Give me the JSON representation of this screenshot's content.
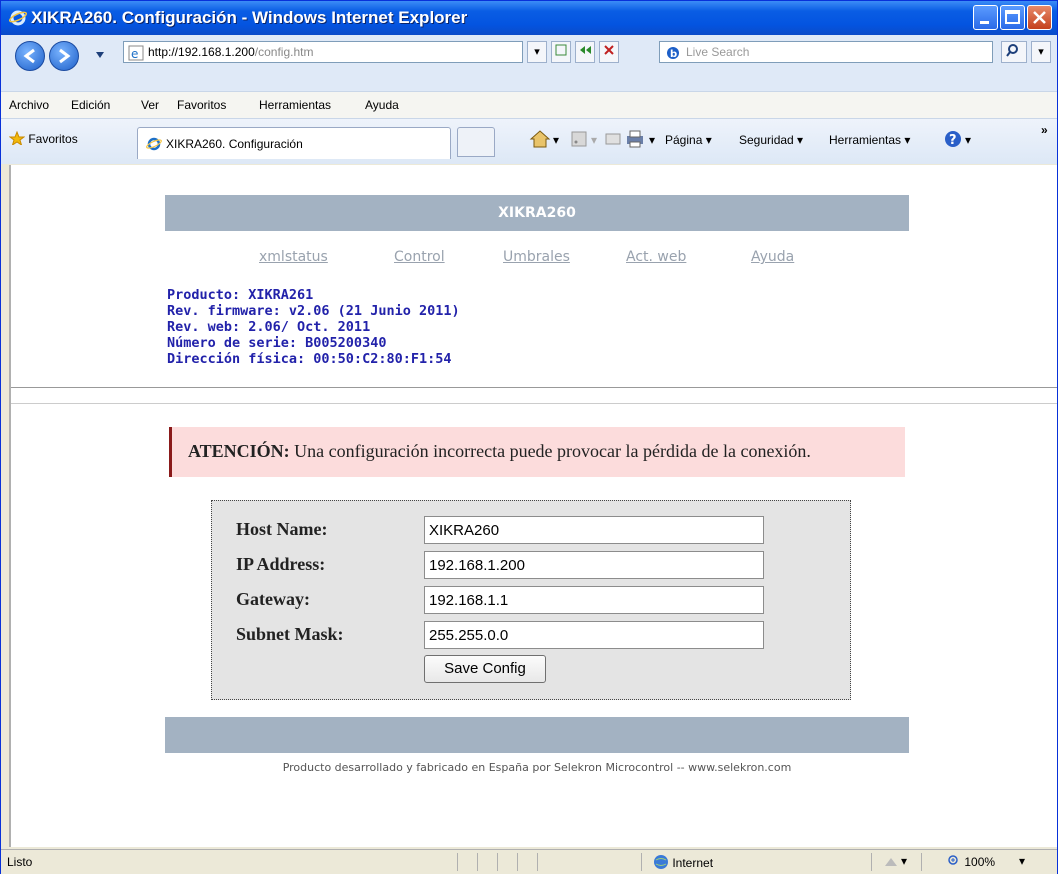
{
  "window": {
    "title": "XIKRA260. Configuración - Windows Internet Explorer"
  },
  "address": {
    "url_host": "http://192.168.1.200",
    "url_path": "/config.htm"
  },
  "search": {
    "placeholder": "Live Search"
  },
  "menu": [
    "Archivo",
    "Edición",
    "Ver",
    "Favoritos",
    "Herramientas",
    "Ayuda"
  ],
  "favorites": {
    "label": "Favoritos"
  },
  "tab": {
    "title": "XIKRA260. Configuración"
  },
  "commandbar": {
    "pagina": "Página",
    "seguridad": "Seguridad",
    "herramientas": "Herramientas"
  },
  "page": {
    "header": "XIKRA260",
    "nav": [
      "xmlstatus",
      "Control",
      "Umbrales",
      "Act. web",
      "Ayuda"
    ],
    "info": [
      "Producto: XIKRA261",
      "Rev. firmware: v2.06 (21 Junio 2011)",
      "Rev. web: 2.06/ Oct. 2011",
      "Número de serie: B005200340",
      "Dirección física: 00:50:C2:80:F1:54"
    ],
    "alert": {
      "title": "ATENCIÓN:",
      "text": "Una configuración incorrecta puede provocar la pérdida de la conexión."
    },
    "form": {
      "fields": [
        {
          "label": "Host Name:",
          "value": "XIKRA260"
        },
        {
          "label": "IP Address:",
          "value": "192.168.1.200"
        },
        {
          "label": "Gateway:",
          "value": "192.168.1.1"
        },
        {
          "label": "Subnet Mask:",
          "value": "255.255.0.0"
        }
      ],
      "save_label": "Save Config"
    },
    "footer": "Producto desarrollado y fabricado en España por Selekron Microcontrol -- www.selekron.com"
  },
  "status": {
    "text": "Listo",
    "zone": "Internet",
    "zoom": "100%"
  },
  "colors": {
    "header_band": "#a3b2c2",
    "info_text": "#2222aa",
    "alert_bg": "#fcdcdc",
    "titlebar": "#0454e0"
  }
}
